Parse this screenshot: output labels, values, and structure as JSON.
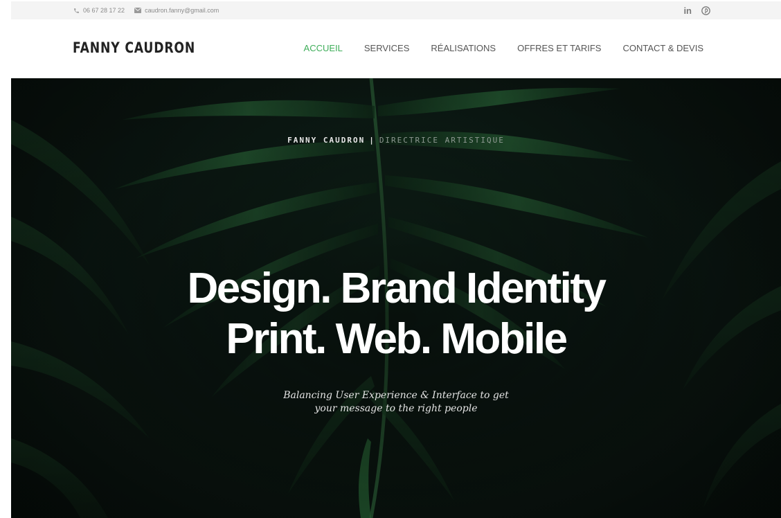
{
  "topbar": {
    "phone": "06 67 28 17 22",
    "email": "caudron.fanny@gmail.com",
    "icons": {
      "phone": "phone-icon",
      "email": "envelope-icon",
      "linkedin": "linkedin-icon",
      "pinterest": "pinterest-icon"
    },
    "linkedin_glyph": "in"
  },
  "header": {
    "logo": "FANNY CAUDRON",
    "nav": [
      "ACCUEIL",
      "SERVICES",
      "RÉALISATIONS",
      "OFFRES ET TARIFS",
      "CONTACT & DEVIS"
    ],
    "active_index": 0
  },
  "hero": {
    "eyebrow_name": "FANNY CAUDRON",
    "eyebrow_separator": "|",
    "eyebrow_role": "DIRECTRICE ARTISTIQUE",
    "headline_line1": "Design. Brand Identity",
    "headline_line2": "Print. Web. Mobile",
    "tagline_line1": "Balancing User Experience & Interface to get",
    "tagline_line2": "your message to the right people",
    "background": "palm-leaves-photo"
  },
  "colors": {
    "accent": "#3fae5a",
    "nav_text": "#555555",
    "topbar_bg": "#f4f4f4",
    "hero_bg": "#0b1712",
    "leaf": "#1f5a2f"
  }
}
